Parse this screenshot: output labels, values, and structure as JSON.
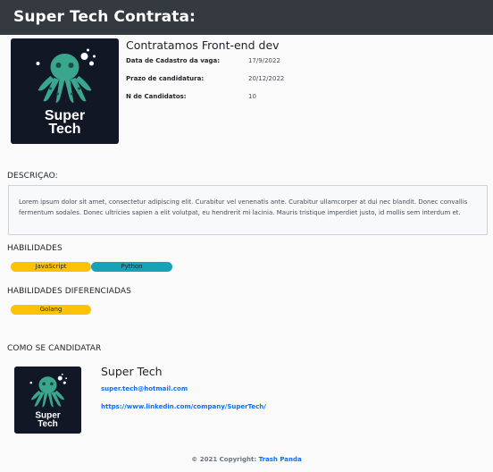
{
  "header": {
    "title": "Super Tech Contrata:"
  },
  "job": {
    "title": "Contratamos Front-end dev",
    "fields": [
      {
        "label": "Data de Cadastro da vaga:",
        "value": "17/9/2022"
      },
      {
        "label": "Prazo de candidatura:",
        "value": "20/12/2022"
      },
      {
        "label": "N de Candidatos:",
        "value": "10"
      }
    ]
  },
  "logo": {
    "line1": "Super",
    "line2": "Tech",
    "icon": "octopus-logo-icon"
  },
  "description": {
    "heading": "DESCRIÇAO:",
    "text": "Lorem ipsum dolor sit amet, consectetur adipiscing elit. Curabitur vel venenatis ante. Curabitur ullamcorper at dui nec blandit. Donec convallis fermentum sodales. Donec ultricies sapien a elit volutpat, eu hendrerit mi lacinia. Mauris tristique imperdiet justo, id mollis sem interdum et."
  },
  "skills": {
    "heading": "HABILIDADES",
    "items": [
      {
        "label": "JavaScript",
        "color": "#ffc107"
      },
      {
        "label": "Python",
        "color": "#17a2b8"
      }
    ]
  },
  "diff_skills": {
    "heading": "HABILIDADES DIFERENCIADAS",
    "items": [
      {
        "label": "Golang",
        "color": "#ffc107"
      }
    ]
  },
  "apply": {
    "heading": "COMO SE CANDIDATAR",
    "company": "Super Tech",
    "email": "super.tech@hotmail.com",
    "linkedin": "https://www.linkedin.com/company/SuperTech/"
  },
  "footer": {
    "copyright": "© 2021 Copyright:",
    "brand": "Trash Panda"
  },
  "colors": {
    "header_bg": "#343a40",
    "link": "#0d6efd",
    "logo_bg": "#121726",
    "octopus": "#3aa68e"
  }
}
